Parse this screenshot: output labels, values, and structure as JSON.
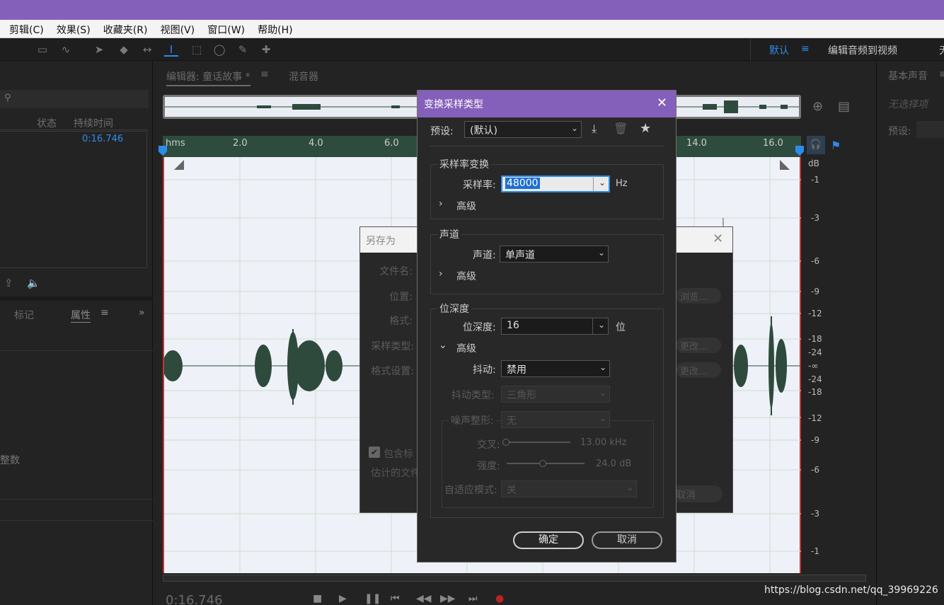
{
  "menu": [
    "剪辑(C)",
    "效果(S)",
    "收藏夹(R)",
    "视图(V)",
    "窗口(W)",
    "帮助(H)"
  ],
  "workspace": {
    "default": "默认",
    "edit_to_video": "编辑音频到视频",
    "more": "无"
  },
  "left_panel": {
    "col_status": "状态",
    "col_duration": "持续时间",
    "duration_value": "0:16.746",
    "tab_markers": "标记",
    "tab_properties": "属性",
    "integer_text": "整数"
  },
  "editor": {
    "tab_editor": "编辑器: 童话故事 *",
    "tab_mixer": "混音器",
    "time_display": "0:16.746"
  },
  "ruler": {
    "labels": [
      "hms",
      "2.0",
      "4.0",
      "6.0",
      "14.0",
      "16.0"
    ]
  },
  "db_scale": {
    "unit": "dB",
    "labels": [
      "-1",
      "-3",
      "-6",
      "-9",
      "-12",
      "-18",
      "-24",
      "-∞",
      "-24",
      "-18",
      "-12",
      "-9",
      "-6",
      "-3",
      "-1"
    ]
  },
  "right_panel": {
    "title": "基本声音",
    "no_selection": "无选择项",
    "preset": "预设:"
  },
  "save_as": {
    "title": "另存为",
    "labels": [
      "文件名:",
      "位置:",
      "格式:",
      "采样类型:",
      "格式设置:"
    ],
    "browse": "浏览...",
    "change1": "更改...",
    "change2": "更改...",
    "include": "包含标",
    "estimate": "估计的文件",
    "cancel": "取消"
  },
  "dialog": {
    "title": "变换采样类型",
    "preset_label": "预设:",
    "preset_value": "(默认)",
    "sr_group": "采样率变换",
    "sr_label": "采样率:",
    "sr_value": "48000",
    "sr_unit": "Hz",
    "advanced": "高级",
    "ch_group": "声道",
    "ch_label": "声道:",
    "ch_value": "单声道",
    "bd_group": "位深度",
    "bd_label": "位深度:",
    "bd_value": "16",
    "bd_unit": "位",
    "dither_label": "抖动:",
    "dither_value": "禁用",
    "dither_type_label": "抖动类型:",
    "dither_type_value": "三角形",
    "noise_label": "噪声整形:",
    "noise_value": "无",
    "cross_label": "交叉:",
    "cross_value": "13.00 kHz",
    "strength_label": "强度:",
    "strength_value": "24.0 dB",
    "adaptive_label": "自适应模式:",
    "adaptive_value": "关",
    "ok": "确定",
    "cancel": "取消"
  },
  "watermark": "https://blog.csdn.net/qq_39969226",
  "colors": {
    "accent_purple": "#8560ba",
    "accent_blue": "#2d8ceb",
    "waveform": "#2d4a3c"
  }
}
